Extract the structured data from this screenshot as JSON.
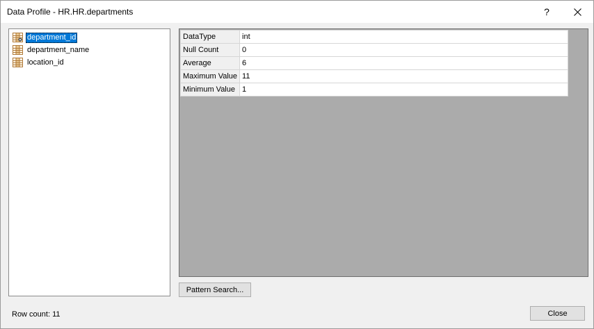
{
  "window": {
    "title": "Data Profile - HR.HR.departments",
    "help_label": "?"
  },
  "columns": [
    {
      "name": "department_id",
      "selected": true
    },
    {
      "name": "department_name",
      "selected": false
    },
    {
      "name": "location_id",
      "selected": false
    }
  ],
  "profile": [
    {
      "key": "DataType",
      "value": "int"
    },
    {
      "key": "Null Count",
      "value": "0"
    },
    {
      "key": "Average",
      "value": "6"
    },
    {
      "key": "Maximum Value",
      "value": "11"
    },
    {
      "key": "Minimum Value",
      "value": "1"
    }
  ],
  "buttons": {
    "pattern_search": "Pattern Search...",
    "close": "Close"
  },
  "footer": {
    "row_count": "Row count: 11"
  },
  "icons": {
    "column": "table-column-icon",
    "close": "close-icon"
  },
  "colors": {
    "selection": "#0078d7",
    "grid_background": "#ababab"
  }
}
